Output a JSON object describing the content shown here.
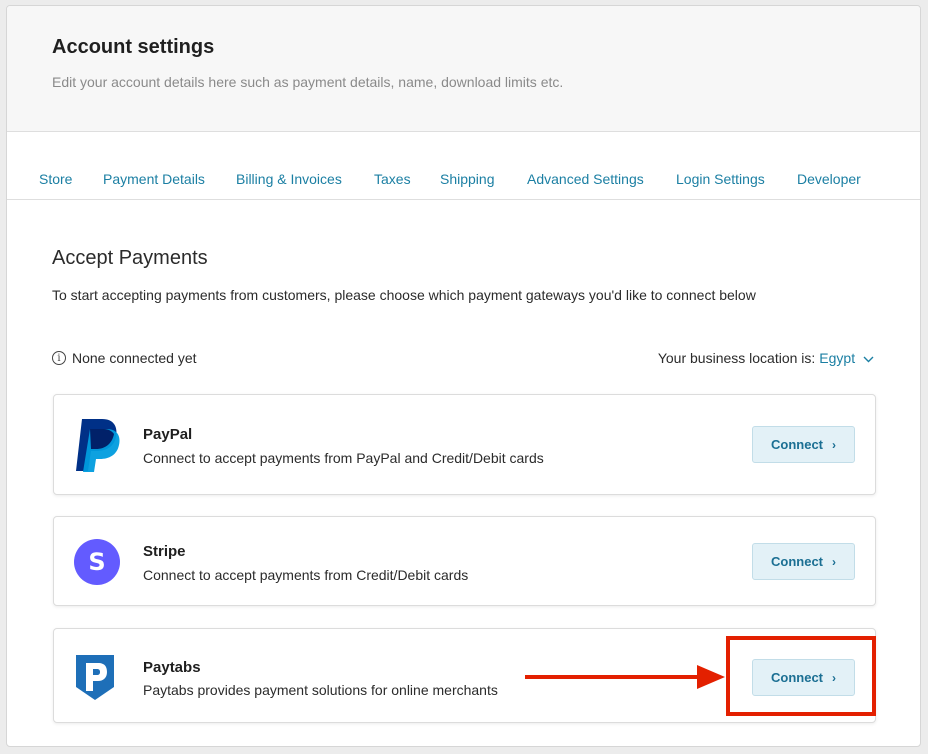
{
  "header": {
    "title": "Account settings",
    "subtitle": "Edit your account details here such as payment details, name, download limits etc."
  },
  "tabs": [
    {
      "label": "Store"
    },
    {
      "label": "Payment Details"
    },
    {
      "label": "Billing & Invoices"
    },
    {
      "label": "Taxes"
    },
    {
      "label": "Shipping"
    },
    {
      "label": "Advanced Settings"
    },
    {
      "label": "Login Settings"
    },
    {
      "label": "Developer"
    }
  ],
  "section": {
    "title": "Accept Payments",
    "subtitle": "To start accepting payments from customers, please choose which payment gateways you'd like to connect below"
  },
  "status": {
    "icon": "info-icon",
    "text": "None connected yet"
  },
  "location": {
    "label": "Your business location is:",
    "country": "Egypt",
    "icon": "chevron-down-icon"
  },
  "gateways": [
    {
      "name": "PayPal",
      "description": "Connect to accept payments from PayPal and Credit/Debit cards",
      "button": "Connect",
      "icon": "paypal-logo-icon"
    },
    {
      "name": "Stripe",
      "description": "Connect to accept payments from Credit/Debit cards",
      "button": "Connect",
      "icon": "stripe-logo-icon"
    },
    {
      "name": "Paytabs",
      "description": "Paytabs provides payment solutions for online merchants",
      "button": "Connect",
      "icon": "paytabs-logo-icon"
    }
  ],
  "colors": {
    "link": "#1b7fa3",
    "button_bg": "#e3f1f7",
    "annotation": "#e32000",
    "stripe": "#635bff",
    "paypal_dark": "#003087",
    "paypal_light": "#009cde",
    "paytabs": "#1e6fb8"
  }
}
